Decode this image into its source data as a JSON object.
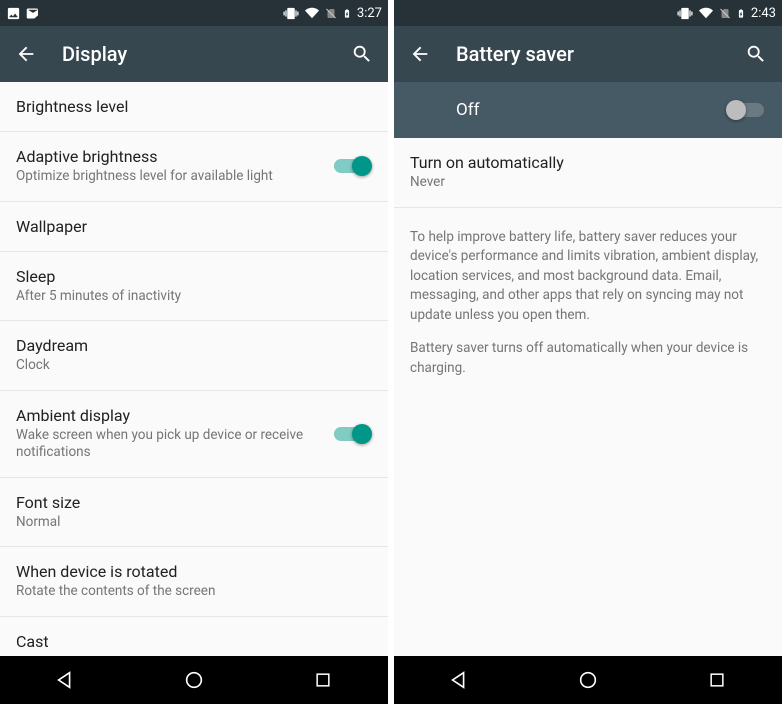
{
  "left": {
    "statusbar": {
      "time": "3:27"
    },
    "appbar": {
      "title": "Display"
    },
    "items": [
      {
        "title": "Brightness level",
        "subtitle": null,
        "toggle": null
      },
      {
        "title": "Adaptive brightness",
        "subtitle": "Optimize brightness level for available light",
        "toggle": "on"
      },
      {
        "title": "Wallpaper",
        "subtitle": null,
        "toggle": null
      },
      {
        "title": "Sleep",
        "subtitle": "After 5 minutes of inactivity",
        "toggle": null
      },
      {
        "title": "Daydream",
        "subtitle": "Clock",
        "toggle": null
      },
      {
        "title": "Ambient display",
        "subtitle": "Wake screen when you pick up device or receive notifications",
        "toggle": "on"
      },
      {
        "title": "Font size",
        "subtitle": "Normal",
        "toggle": null
      },
      {
        "title": "When device is rotated",
        "subtitle": "Rotate the contents of the screen",
        "toggle": null
      },
      {
        "title": "Cast",
        "subtitle": null,
        "toggle": null
      }
    ]
  },
  "right": {
    "statusbar": {
      "time": "2:43"
    },
    "appbar": {
      "title": "Battery saver"
    },
    "subbar": {
      "label": "Off",
      "toggle": "off"
    },
    "items": [
      {
        "title": "Turn on automatically",
        "subtitle": "Never"
      }
    ],
    "description": {
      "p1": "To help improve battery life, battery saver reduces your device's performance and limits vibration, ambient display, location services, and most background data. Email, messaging, and other apps that rely on syncing may not update unless you open them.",
      "p2": "Battery saver turns off automatically when your device is charging."
    }
  }
}
